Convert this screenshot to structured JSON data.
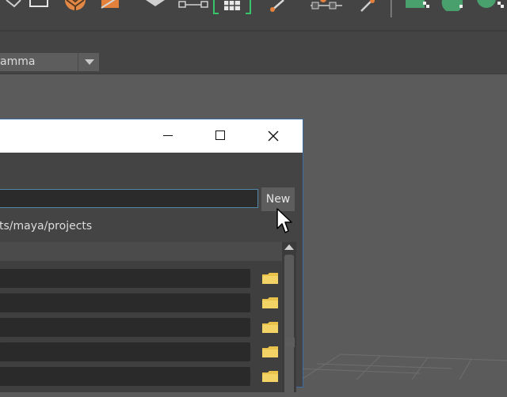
{
  "app": {
    "colorspace_value": "amma",
    "colors": {
      "accent": "#3a6ea5",
      "folder": "#e8c24a",
      "shelf_green": "#49a06d",
      "shelf_orange": "#e2803c"
    }
  },
  "shelf": {
    "icons": [
      "shelf-tool-icon",
      "shelf-square-icon",
      "soccer-ball-icon",
      "orange-shape-icon",
      "diamond-icon",
      "connect-icon",
      "grid-frame-icon",
      "pen-tool-icon",
      "node-chain-icon",
      "paint-icon",
      "green-shape-icon",
      "green-curve-icon",
      "green-circle-icon"
    ]
  },
  "dialog": {
    "window_controls": {
      "minimize": "minimize-icon",
      "maximize": "maximize-icon",
      "close": "close-icon"
    },
    "name_input_value": "",
    "new_button_label": "New",
    "path_text": "ts/maya/projects",
    "rows": 5
  }
}
